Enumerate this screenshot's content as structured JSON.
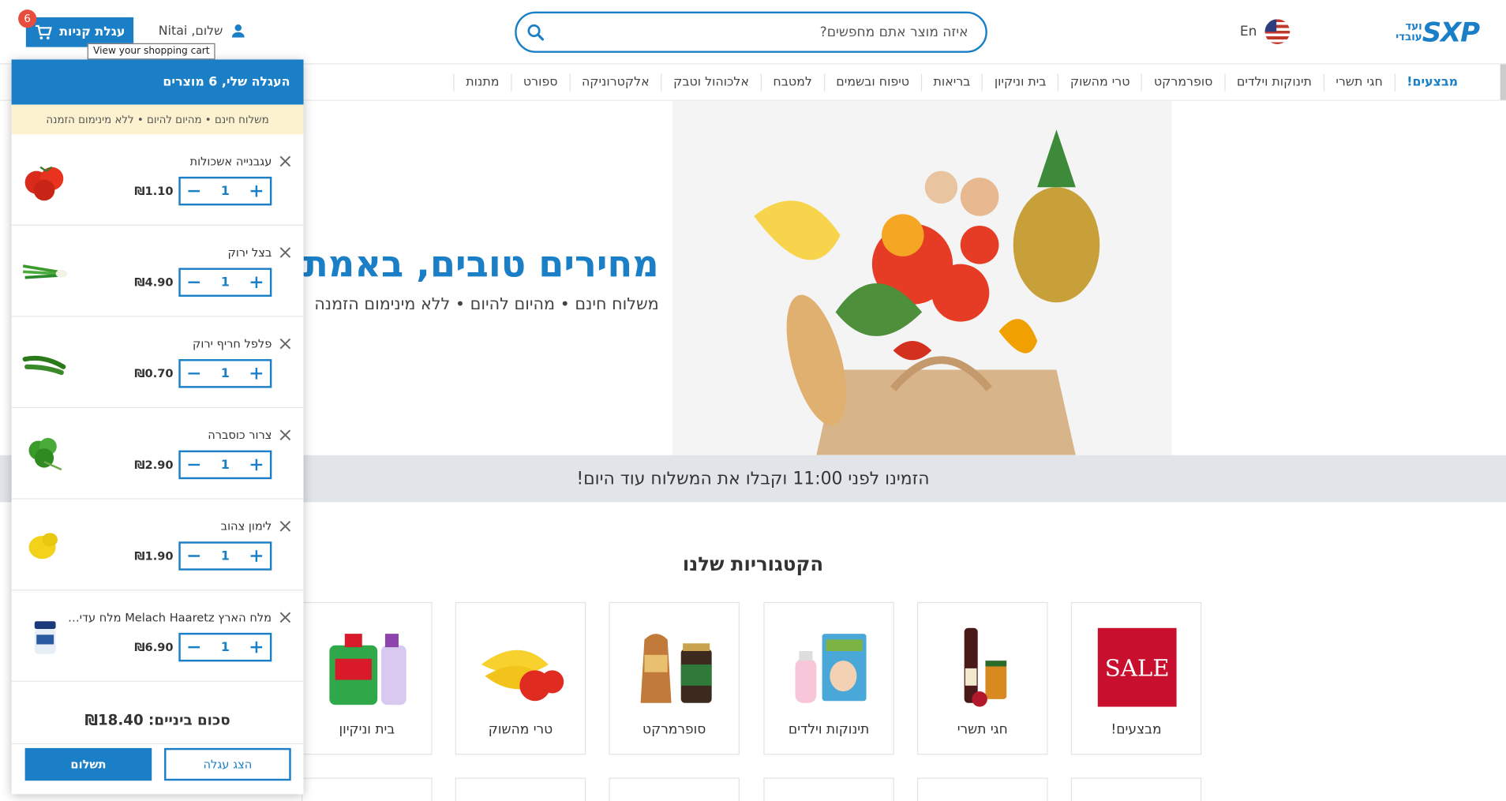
{
  "header": {
    "logo_main": "SXP",
    "logo_small": "ועד עובדי",
    "lang_label": "En",
    "search_placeholder": "איזה מוצר אתם מחפשים?",
    "greeting": "שלום, Nitai",
    "cart_button_label": "עגלת קניות",
    "cart_count": "6",
    "cart_tooltip": "View your shopping cart"
  },
  "nav": {
    "items": [
      "מבצעים!",
      "חגי תשרי",
      "תינוקות וילדים",
      "סופרמרקט",
      "טרי מהשוק",
      "בית וניקיון",
      "בריאות",
      "טיפוח ובשמים",
      "למטבח",
      "אלכוהול וטבק",
      "אלקטרוניקה",
      "ספורט",
      "מתנות"
    ]
  },
  "hero": {
    "title": "מחירים טובים, באמת.",
    "subtitle": "משלוח חינם • מהיום להיום • ללא מינימום הזמנה",
    "banner": "הזמינו לפני 11:00 וקבלו את המשלוח עוד היום!"
  },
  "categories": {
    "title": "הקטגוריות שלנו",
    "items": [
      "מבצעים!",
      "חגי תשרי",
      "תינוקות וילדים",
      "סופרמרקט",
      "טרי מהשוק",
      "בית וניקיון"
    ],
    "sale_text": "SALE"
  },
  "cart": {
    "header": "העגלה שלי, 6 מוצרים",
    "note": "משלוח חינם • מהיום להיום • ללא מינימום הזמנה",
    "items": [
      {
        "name": "עגבנייה אשכולות",
        "qty": "1",
        "price": "₪1.10"
      },
      {
        "name": "בצל ירוק",
        "qty": "1",
        "price": "₪4.90"
      },
      {
        "name": "פלפל חריף ירוק",
        "qty": "1",
        "price": "₪0.70"
      },
      {
        "name": "צרור כוסברה",
        "qty": "1",
        "price": "₪2.90"
      },
      {
        "name": "לימון צהוב",
        "qty": "1",
        "price": "₪1.90"
      },
      {
        "name": "מלח הארץ Melach Haaretz מלח עדין בצנצנת",
        "qty": "1",
        "price": "₪6.90"
      }
    ],
    "subtotal": "סכום ביניים: ₪18.40",
    "show_cart_label": "הצג עגלה",
    "pay_label": "תשלום"
  },
  "colors": {
    "accent": "#1a7fc6",
    "badge": "#e74c3c",
    "note_bg": "#fdf2d0",
    "banner_bg": "#e1e5ea"
  }
}
